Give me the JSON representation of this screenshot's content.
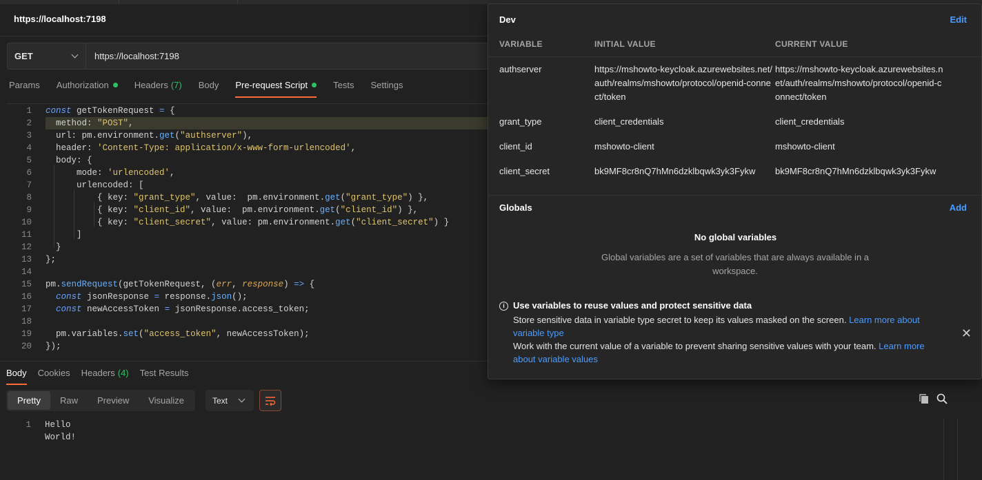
{
  "header": {
    "title": "https://localhost:7198"
  },
  "request": {
    "method": "GET",
    "url": "https://localhost:7198"
  },
  "request_tabs": [
    {
      "label": "Params"
    },
    {
      "label": "Authorization"
    },
    {
      "label": "Headers",
      "count": "(7)"
    },
    {
      "label": "Body"
    },
    {
      "label": "Pre-request Script"
    },
    {
      "label": "Tests"
    },
    {
      "label": "Settings"
    }
  ],
  "code": {
    "line_numbers": [
      "1",
      "2",
      "3",
      "4",
      "5",
      "6",
      "7",
      "8",
      "9",
      "10",
      "11",
      "12",
      "13",
      "14",
      "15",
      "16",
      "17",
      "18",
      "19",
      "20"
    ]
  },
  "response_tabs": [
    {
      "label": "Body"
    },
    {
      "label": "Cookies"
    },
    {
      "label": "Headers",
      "count": "(4)"
    },
    {
      "label": "Test Results"
    }
  ],
  "response_views": [
    "Pretty",
    "Raw",
    "Preview",
    "Visualize"
  ],
  "response_format": "Text",
  "response_body": {
    "line": "1",
    "text": "Hello World!"
  },
  "env_popover": {
    "env_name": "Dev",
    "edit_label": "Edit",
    "columns": [
      "VARIABLE",
      "INITIAL VALUE",
      "CURRENT VALUE"
    ],
    "rows": [
      {
        "variable": "authserver",
        "initial": "https://mshowto-keycloak.azurewebsites.net/auth/realms/mshowto/protocol/openid-connect/token",
        "current": "https://mshowto-keycloak.azurewebsites.net/auth/realms/mshowto/protocol/openid-connect/token"
      },
      {
        "variable": "grant_type",
        "initial": "client_credentials",
        "current": "client_credentials"
      },
      {
        "variable": "client_id",
        "initial": "mshowto-client",
        "current": "mshowto-client"
      },
      {
        "variable": "client_secret",
        "initial": "bk9MF8cr8nQ7hMn6dzklbqwk3yk3Fykw",
        "current": "bk9MF8cr8nQ7hMn6dzklbqwk3yk3Fykw"
      }
    ],
    "globals_title": "Globals",
    "add_label": "Add",
    "empty_title": "No global variables",
    "empty_desc": "Global variables are a set of variables that are always available in a workspace.",
    "info_title": "Use variables to reuse values and protect sensitive data",
    "info_line1": "Store sensitive data in variable type secret to keep its values masked on the screen.",
    "info_link1": "Learn more about variable type",
    "info_line2": "Work with the current value of a variable to prevent sharing sensitive values with your team.",
    "info_link2": "Learn more about variable values"
  },
  "icons": [
    "chevron-down-icon",
    "wrap-lines-icon",
    "copy-icon",
    "search-icon",
    "info-icon",
    "close-icon"
  ],
  "colors": {
    "accent": "#ff6c37",
    "link": "#4a9cff",
    "status_dot": "#30c06a"
  }
}
